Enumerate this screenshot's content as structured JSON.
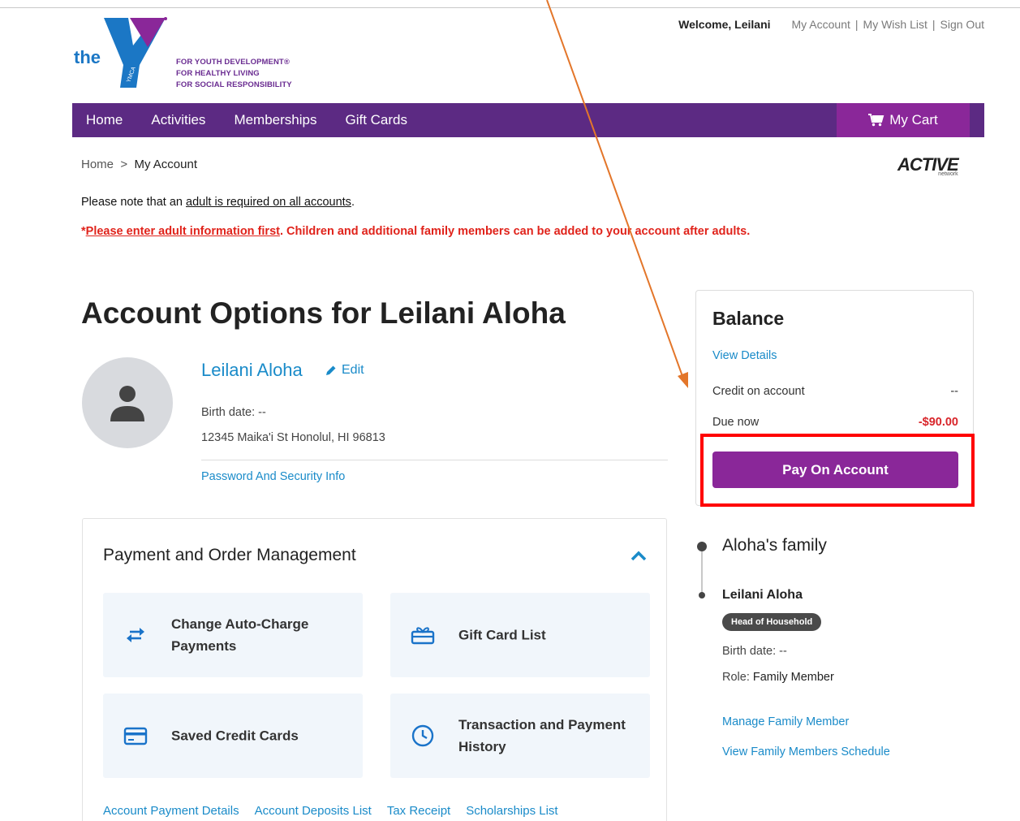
{
  "logo": {
    "the_text": "the",
    "ymca_text": "YMCA",
    "tagline": [
      "FOR YOUTH DEVELOPMENT®",
      "FOR HEALTHY LIVING",
      "FOR SOCIAL RESPONSIBILITY"
    ]
  },
  "header": {
    "welcome": "Welcome, Leilani",
    "my_account": "My Account",
    "my_wish_list": "My Wish List",
    "sign_out": "Sign Out",
    "separator": "|"
  },
  "nav": {
    "items": [
      "Home",
      "Activities",
      "Memberships",
      "Gift Cards"
    ],
    "cart": "My Cart"
  },
  "breadcrumb": {
    "home": "Home",
    "separator": ">",
    "current": "My Account"
  },
  "brand": {
    "active": "ACTIVE",
    "network": "network"
  },
  "notices": {
    "line1_prefix": "Please note that an ",
    "line1_link": "adult is required on all accounts",
    "line1_suffix": ".",
    "line2_star": "*",
    "line2_link": "Please enter adult information first",
    "line2_suffix": ". Children and additional family members can be added to your account after adults."
  },
  "page": {
    "title": "Account Options for Leilani Aloha"
  },
  "profile": {
    "name": "Leilani Aloha",
    "edit": "Edit",
    "birth_date": "Birth date: --",
    "address": "12345 Maika'i St Honolul, HI 96813",
    "password_link": "Password And Security Info"
  },
  "payment_panel": {
    "title": "Payment and Order Management",
    "tiles": [
      {
        "label": "Change Auto-Charge Payments",
        "icon": "swap-arrows-icon"
      },
      {
        "label": "Gift Card List",
        "icon": "gift-card-icon"
      },
      {
        "label": "Saved Credit Cards",
        "icon": "credit-card-icon"
      },
      {
        "label": "Transaction and Payment History",
        "icon": "clock-icon"
      }
    ],
    "links": [
      "Account Payment Details",
      "Account Deposits List",
      "Tax Receipt",
      "Scholarships List"
    ]
  },
  "balance": {
    "title": "Balance",
    "view_details": "View Details",
    "credit_label": "Credit on account",
    "credit_value": "--",
    "due_label": "Due now",
    "due_value": "-$90.00",
    "pay_button": "Pay On Account"
  },
  "family": {
    "title": "Aloha's family",
    "member_name": "Leilani Aloha",
    "badge": "Head of Household",
    "birth_date": "Birth date: --",
    "role_label": "Role: ",
    "role_value": "Family Member",
    "manage_link": "Manage Family Member",
    "schedule_link": "View Family Members Schedule"
  },
  "colors": {
    "nav_purple": "#5c2a83",
    "accent_purple": "#8a2799",
    "link_blue": "#1a8bc9",
    "due_red": "#d8252a",
    "highlight_red": "#ff0000",
    "arrow_orange": "#e3762a"
  }
}
